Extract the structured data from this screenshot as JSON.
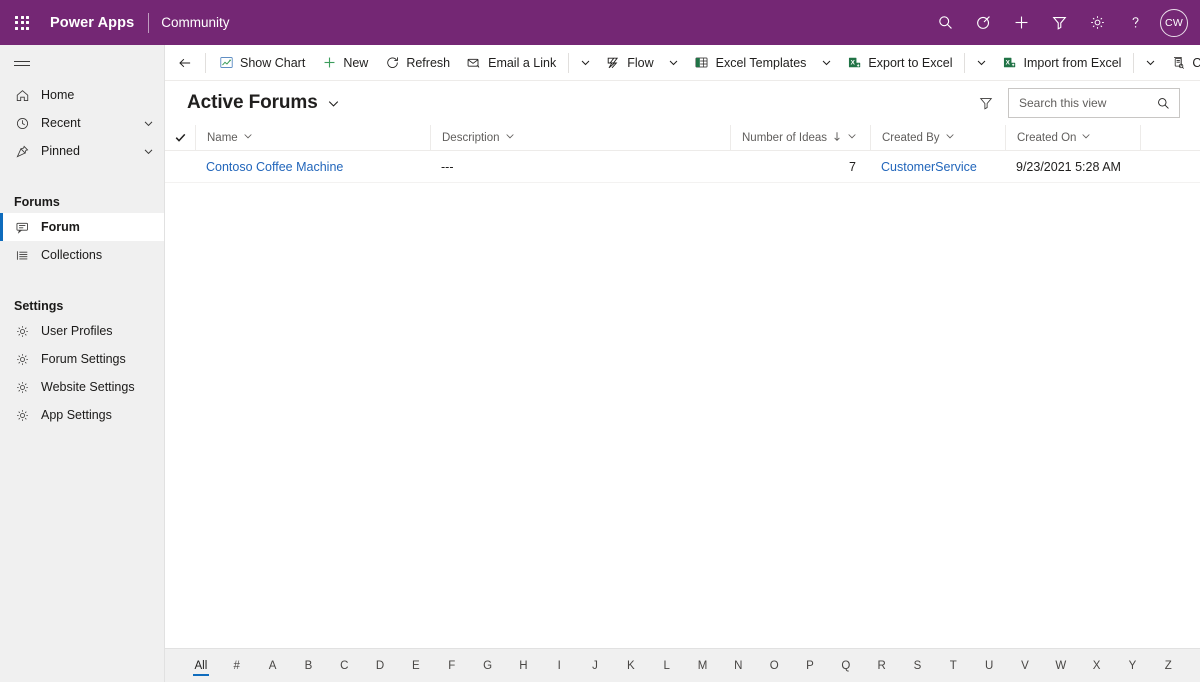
{
  "topbar": {
    "waffle_label": "app-launcher",
    "brand": "Power Apps",
    "app_name": "Community",
    "icons": [
      {
        "name": "search-icon",
        "label": "Search"
      },
      {
        "name": "assistant-icon",
        "label": "Assistant"
      },
      {
        "name": "plus-icon",
        "label": "New"
      },
      {
        "name": "filter-icon",
        "label": "Filter"
      },
      {
        "name": "gear-icon",
        "label": "Settings"
      },
      {
        "name": "help-icon",
        "label": "Help"
      }
    ],
    "avatar_initials": "CW",
    "accent_color": "#742774"
  },
  "sidebar": {
    "hamburger_label": "Expand / collapse navigation",
    "items": [
      {
        "label": "Home",
        "icon": "home-icon",
        "chevron": false,
        "selected": false
      },
      {
        "label": "Recent",
        "icon": "clock-icon",
        "chevron": true,
        "selected": false
      },
      {
        "label": "Pinned",
        "icon": "pin-icon",
        "chevron": true,
        "selected": false
      }
    ],
    "groups": [
      {
        "title": "Forums",
        "items": [
          {
            "label": "Forum",
            "icon": "forum-icon",
            "selected": true
          },
          {
            "label": "Collections",
            "icon": "collections-icon",
            "selected": false
          }
        ]
      },
      {
        "title": "Settings",
        "items": [
          {
            "label": "User Profiles",
            "icon": "gear-icon",
            "selected": false
          },
          {
            "label": "Forum Settings",
            "icon": "gear-icon",
            "selected": false
          },
          {
            "label": "Website Settings",
            "icon": "gear-icon",
            "selected": false
          },
          {
            "label": "App Settings",
            "icon": "gear-icon",
            "selected": false
          }
        ]
      }
    ],
    "selected_accent_color": "#0f6cbd"
  },
  "commandbar": {
    "back_label": "Back",
    "commands": [
      {
        "label": "Show Chart",
        "icon": "show-chart-icon",
        "caret": false
      },
      {
        "label": "New",
        "icon": "plus-icon",
        "caret": false
      },
      {
        "label": "Refresh",
        "icon": "refresh-icon",
        "caret": false
      },
      {
        "label": "Email a Link",
        "icon": "email-link-icon",
        "caret": true
      },
      {
        "label": "Flow",
        "icon": "flow-icon",
        "caret": true
      },
      {
        "label": "Excel Templates",
        "icon": "excel-templates-icon",
        "caret": true
      },
      {
        "label": "Export to Excel",
        "icon": "export-excel-icon",
        "caret": true
      },
      {
        "label": "Import from Excel",
        "icon": "import-excel-icon",
        "caret": true
      },
      {
        "label": "Create view",
        "icon": "create-view-icon",
        "caret": false
      }
    ]
  },
  "view": {
    "title": "Active Forums",
    "title_caret": "chevron-down-icon",
    "filter_icon": "filter-icon",
    "search_placeholder": "Search this view",
    "search_value": ""
  },
  "grid": {
    "select_all_icon": "checkmark-icon",
    "columns": [
      {
        "label": "Name",
        "key": "name",
        "sort": null
      },
      {
        "label": "Description",
        "key": "description",
        "sort": null
      },
      {
        "label": "Number of Ideas",
        "key": "number_of_ideas",
        "sort": "desc"
      },
      {
        "label": "Created By",
        "key": "created_by",
        "sort": null
      },
      {
        "label": "Created On",
        "key": "created_on",
        "sort": null
      }
    ],
    "rows": [
      {
        "name": "Contoso Coffee Machine",
        "description": "---",
        "number_of_ideas": "7",
        "created_by": "CustomerService",
        "created_on": "9/23/2021 5:28 AM"
      }
    ]
  },
  "alphabar": {
    "active": "All",
    "items": [
      "All",
      "#",
      "A",
      "B",
      "C",
      "D",
      "E",
      "F",
      "G",
      "H",
      "I",
      "J",
      "K",
      "L",
      "M",
      "N",
      "O",
      "P",
      "Q",
      "R",
      "S",
      "T",
      "U",
      "V",
      "W",
      "X",
      "Y",
      "Z"
    ]
  }
}
